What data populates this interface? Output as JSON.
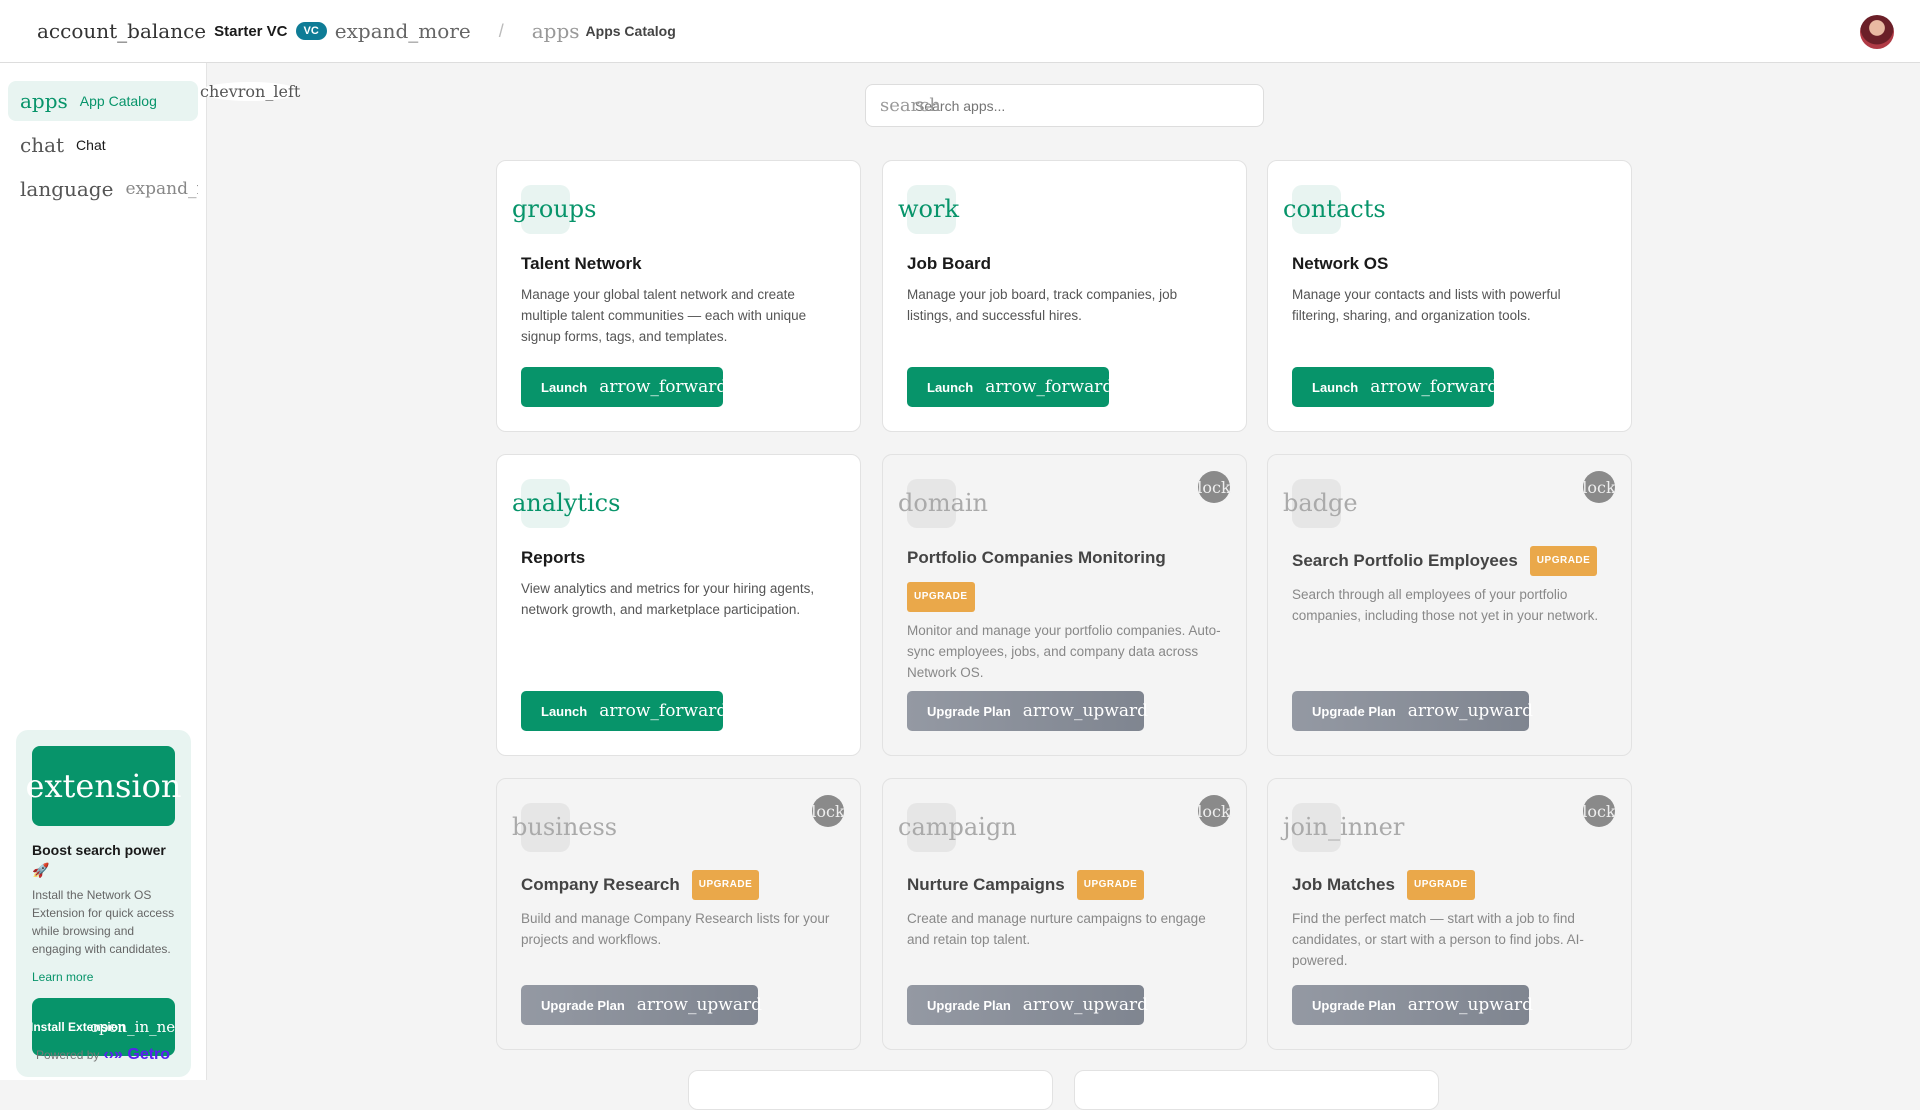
{
  "header": {
    "org_icon": "account_balance",
    "org_name": "Starter VC",
    "org_badge": "VC",
    "org_expand": "expand_more",
    "separator": "/",
    "crumb_icon": "apps",
    "crumb_label": "Apps Catalog"
  },
  "sidebar": {
    "items": [
      {
        "icon": "apps",
        "label": "App Catalog"
      },
      {
        "icon": "chat",
        "label": "Chat"
      },
      {
        "icon": "language",
        "label": "expand_more"
      }
    ],
    "collapse_icon": "chevron_left",
    "promo": {
      "icon": "extension",
      "title": "Boost search power 🚀",
      "text": "Install the Network OS Extension for quick access while browsing and engaging with candidates.",
      "link": "Learn more",
      "button": "Install Extension",
      "button_icon": "open_in_new"
    },
    "powered_by": "Powered by",
    "brand": "Getro"
  },
  "search": {
    "icon": "search",
    "placeholder": "Search apps..."
  },
  "apps": [
    {
      "icon": "groups",
      "title": "Talent Network",
      "desc": "Manage your global talent network and create multiple talent communities — each with unique signup forms, tags, and templates.",
      "locked": false,
      "button": "Launch",
      "button_icon": "arrow_forward"
    },
    {
      "icon": "work",
      "title": "Job Board",
      "desc": "Manage your job board, track companies, job listings, and successful hires.",
      "locked": false,
      "button": "Launch",
      "button_icon": "arrow_forward"
    },
    {
      "icon": "contacts",
      "title": "Network OS",
      "desc": "Manage your contacts and lists with powerful filtering, sharing, and organization tools.",
      "locked": false,
      "button": "Launch",
      "button_icon": "arrow_forward"
    },
    {
      "icon": "analytics",
      "title": "Reports",
      "desc": "View analytics and metrics for your hiring agents, network growth, and marketplace participation.",
      "locked": false,
      "button": "Launch",
      "button_icon": "arrow_forward"
    },
    {
      "icon": "domain",
      "title": "Portfolio Companies Monitoring",
      "badge": "UPGRADE",
      "desc": "Monitor and manage your portfolio companies. Auto-sync employees, jobs, and company data across Network OS.",
      "locked": true,
      "lock_icon": "lock",
      "button": "Upgrade Plan",
      "button_icon": "arrow_upward"
    },
    {
      "icon": "badge",
      "title": "Search Portfolio Employees",
      "badge": "UPGRADE",
      "desc": "Search through all employees of your portfolio companies, including those not yet in your network.",
      "locked": true,
      "lock_icon": "lock",
      "button": "Upgrade Plan",
      "button_icon": "arrow_upward"
    },
    {
      "icon": "business",
      "title": "Company Research",
      "badge": "UPGRADE",
      "desc": "Build and manage Company Research lists for your projects and workflows.",
      "locked": true,
      "lock_icon": "lock",
      "button": "Upgrade Plan",
      "button_icon": "arrow_upward"
    },
    {
      "icon": "campaign",
      "title": "Nurture Campaigns",
      "badge": "UPGRADE",
      "desc": "Create and manage nurture campaigns to engage and retain top talent.",
      "locked": true,
      "lock_icon": "lock",
      "button": "Upgrade Plan",
      "button_icon": "arrow_upward"
    },
    {
      "icon": "join_inner",
      "title": "Job Matches",
      "badge": "UPGRADE",
      "desc": "Find the perfect match — start with a job to find candidates, or start with a person to find jobs. AI-powered.",
      "locked": true,
      "lock_icon": "lock",
      "button": "Upgrade Plan",
      "button_icon": "arrow_upward"
    }
  ]
}
